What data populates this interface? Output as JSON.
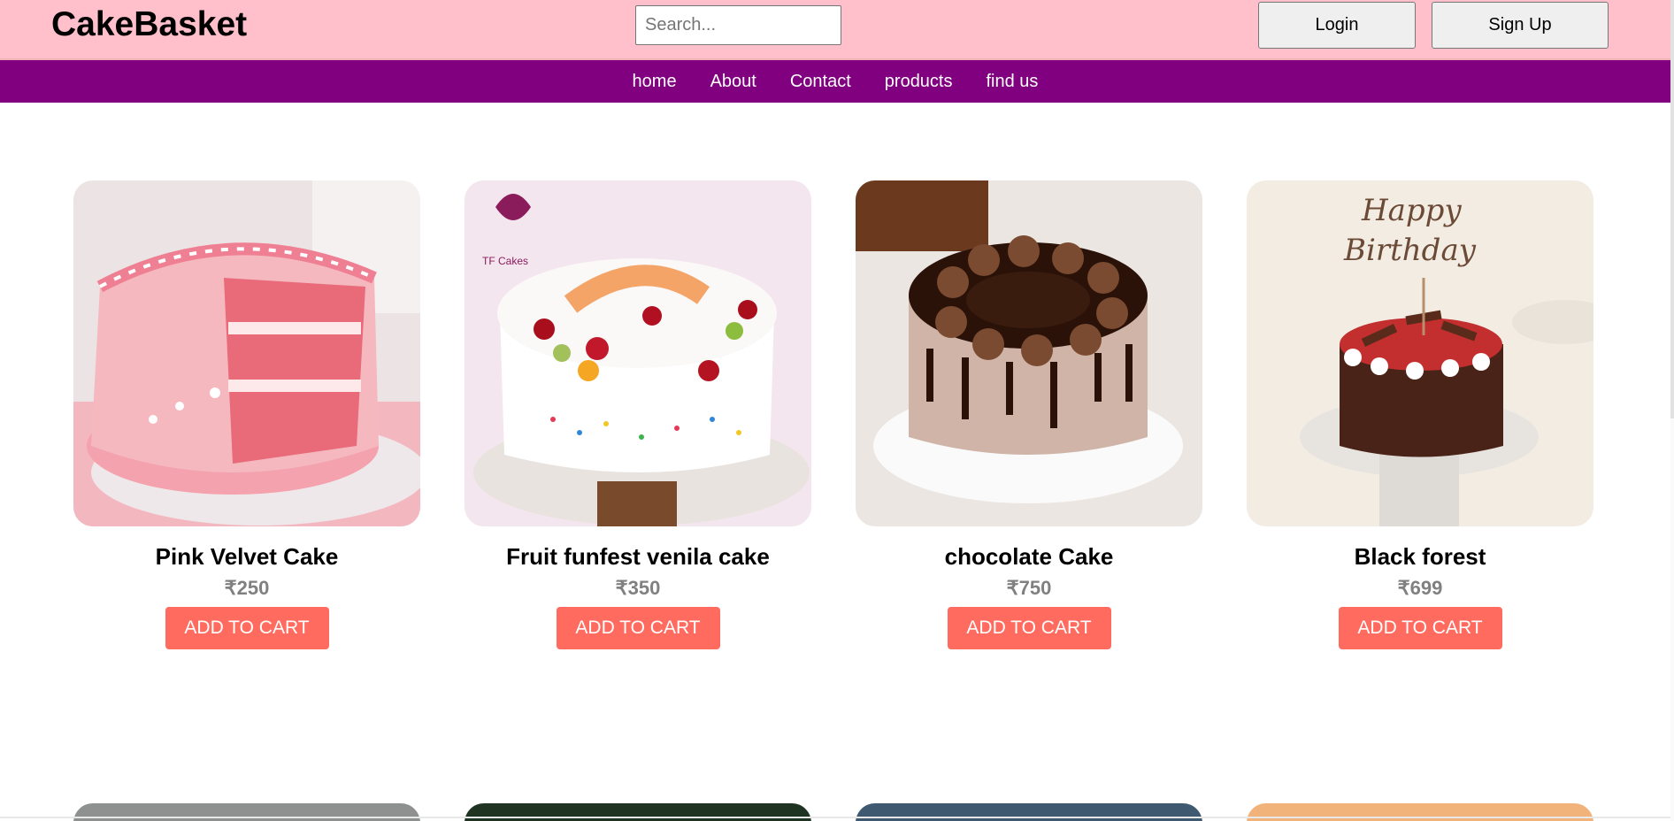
{
  "header": {
    "brand": "CakeBasket",
    "search_placeholder": "Search...",
    "login_label": "Login",
    "signup_label": "Sign Up"
  },
  "nav": {
    "items": [
      "home",
      "About",
      "Contact",
      "products",
      "find us"
    ]
  },
  "products": [
    {
      "name": "Pink Velvet Cake",
      "price": "₹250",
      "button": "ADD TO CART"
    },
    {
      "name": "Fruit funfest venila cake",
      "price": "₹350",
      "button": "ADD TO CART"
    },
    {
      "name": "chocolate Cake",
      "price": "₹750",
      "button": "ADD TO CART"
    },
    {
      "name": "Black forest",
      "price": "₹699",
      "button": "ADD TO CART"
    }
  ],
  "images": {
    "fruit_cake_logo": "TF Cakes",
    "birthday_topper": [
      "Happy",
      "Birthday"
    ]
  },
  "colors": {
    "header_bg": "#ffc0cb",
    "nav_bg": "#800080",
    "button_bg": "#ff6b5f",
    "price": "#808080"
  }
}
